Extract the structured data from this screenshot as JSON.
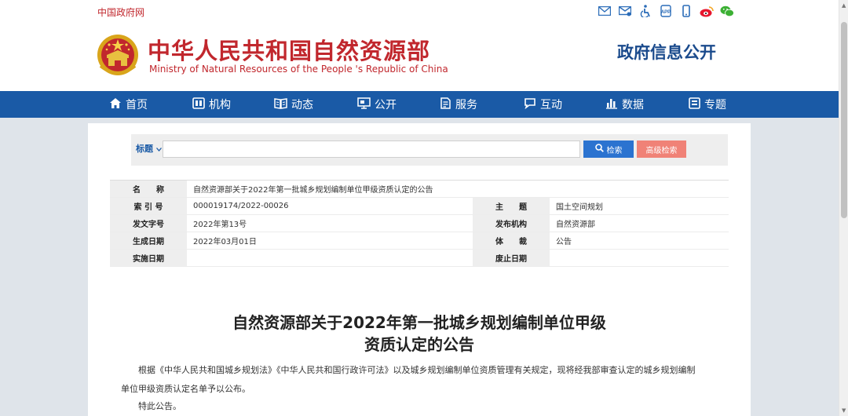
{
  "topbar": {
    "gov_link": "中国政府网",
    "icons": [
      "mail-icon",
      "message-icon",
      "accessibility-icon",
      "app-icon",
      "mobile-icon",
      "weibo-icon",
      "wechat-icon"
    ]
  },
  "header": {
    "title": "中华人民共和国自然资源部",
    "subtitle": "Ministry of Natural Resources of the People 's Republic of China",
    "info_open": "政府信息公开"
  },
  "nav": {
    "items": [
      {
        "label": "首页",
        "icon": "home-icon"
      },
      {
        "label": "机构",
        "icon": "org-icon"
      },
      {
        "label": "动态",
        "icon": "book-icon"
      },
      {
        "label": "公开",
        "icon": "screen-icon"
      },
      {
        "label": "服务",
        "icon": "service-icon"
      },
      {
        "label": "互动",
        "icon": "chat-icon"
      },
      {
        "label": "数据",
        "icon": "chart-icon"
      },
      {
        "label": "专题",
        "icon": "topic-icon"
      }
    ]
  },
  "search": {
    "select_label": "标题",
    "query": "",
    "search_button": "检索",
    "advanced_button": "高级检索"
  },
  "meta": {
    "name_label": "名　　称",
    "name_value": "自然资源部关于2022年第一批城乡规划编制单位甲级资质认定的公告",
    "index_label": "索 引 号",
    "index_value": "000019174/2022-00026",
    "subject_label": "主　　题",
    "subject_value": "国土空间规划",
    "docno_label": "发文字号",
    "docno_value": "2022年第13号",
    "issuer_label": "发布机构",
    "issuer_value": "自然资源部",
    "date_label": "生成日期",
    "date_value": "2022年03月01日",
    "genre_label": "体　　裁",
    "genre_value": "公告",
    "impl_label": "实施日期",
    "impl_value": "",
    "expire_label": "废止日期",
    "expire_value": ""
  },
  "document": {
    "title_line1": "自然资源部关于2022年第一批城乡规划编制单位甲级",
    "title_line2": "资质认定的公告",
    "para1_line1": "根据《中华人民共和国城乡规划法》《中华人民共和国行政许可法》以及城乡规划编制单位资质管理有关规定，现将经我部审查认定的城乡规划编制",
    "para1_line2": "单位甲级资质认定名单予以公布。",
    "para2": "特此公告。"
  },
  "colors": {
    "brand_red": "#c1272d",
    "nav_blue": "#1a5aa6",
    "search_blue": "#2b73d0",
    "advanced_pink": "#f08277"
  }
}
